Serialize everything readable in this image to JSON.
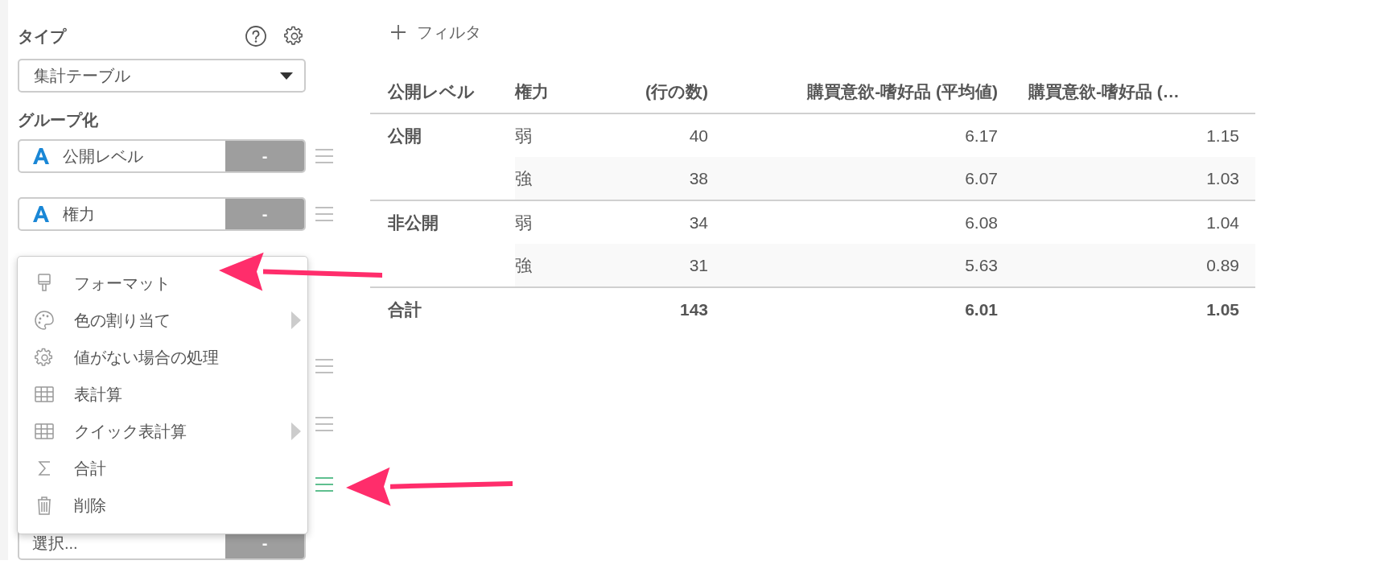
{
  "sidebar": {
    "type_label": "タイプ",
    "type_select": {
      "value": "集計テーブル"
    },
    "group_label": "グループ化",
    "group_fields": [
      {
        "label": "公開レベル",
        "remove": "-"
      },
      {
        "label": "権力",
        "remove": "-"
      }
    ],
    "covered_rows": [
      {
        "handle_active": false
      },
      {
        "handle_active": false
      },
      {
        "handle_active": true
      }
    ],
    "value_select": {
      "placeholder": "選択...",
      "remove": "-"
    }
  },
  "context_menu": {
    "items": [
      {
        "label": "フォーマット",
        "submenu": false
      },
      {
        "label": "色の割り当て",
        "submenu": true
      },
      {
        "label": "値がない場合の処理",
        "submenu": false
      },
      {
        "label": "表計算",
        "submenu": false
      },
      {
        "label": "クイック表計算",
        "submenu": true
      },
      {
        "label": "合計",
        "submenu": false
      },
      {
        "label": "削除",
        "submenu": false
      }
    ]
  },
  "filter": {
    "label": "フィルタ"
  },
  "table": {
    "columns": [
      "公開レベル",
      "権力",
      "(行の数)",
      "購買意欲-嗜好品 (平均値)",
      "購買意欲-嗜好品 (…"
    ],
    "groups": [
      {
        "label": "公開",
        "rows": [
          [
            "弱",
            "40",
            "6.17",
            "1.15"
          ],
          [
            "強",
            "38",
            "6.07",
            "1.03"
          ]
        ]
      },
      {
        "label": "非公開",
        "rows": [
          [
            "弱",
            "34",
            "6.08",
            "1.04"
          ],
          [
            "強",
            "31",
            "5.63",
            "0.89"
          ]
        ]
      }
    ],
    "total": {
      "label": "合計",
      "values": [
        "143",
        "6.01",
        "1.05"
      ]
    }
  },
  "annotations": [
    {
      "kind": "arrow"
    },
    {
      "kind": "arrow"
    }
  ]
}
